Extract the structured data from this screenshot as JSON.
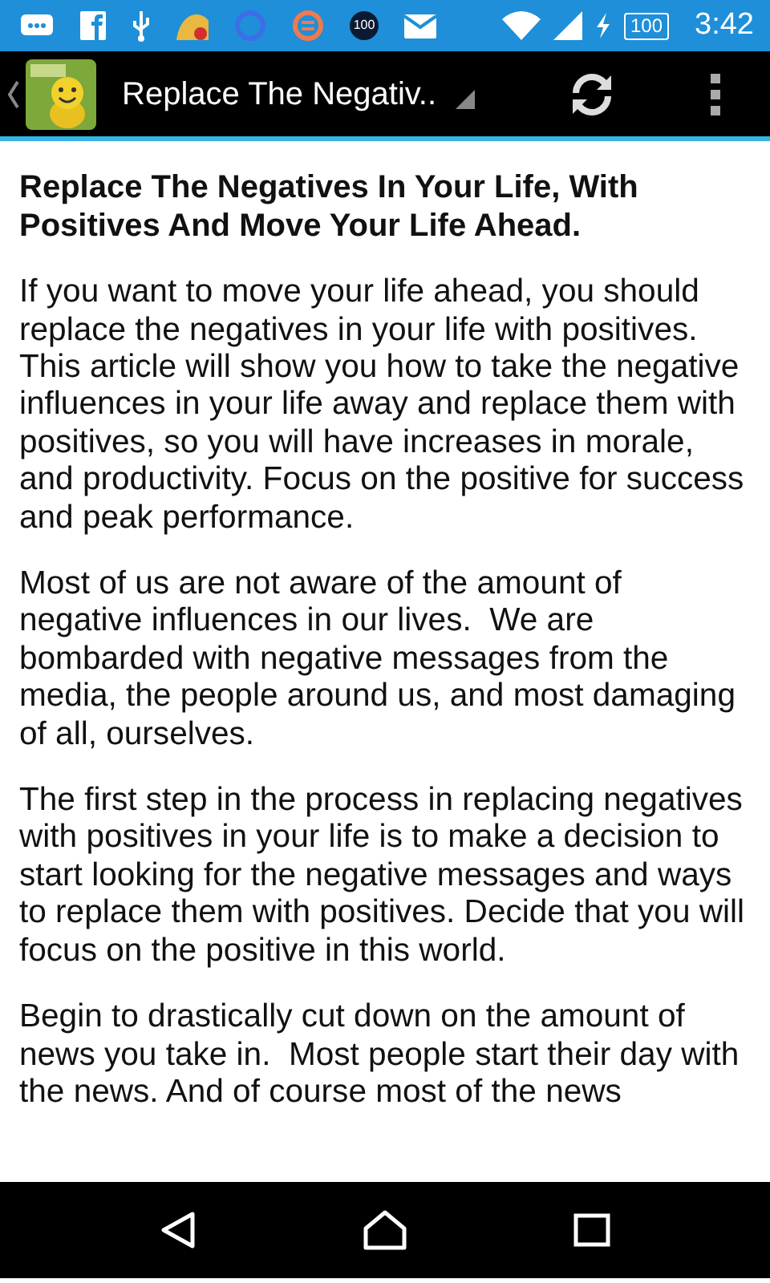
{
  "status_bar": {
    "notification_badge": "100",
    "battery": "100",
    "time": "3:42"
  },
  "app_bar": {
    "title": "Replace The Negativ.."
  },
  "article": {
    "heading": "Replace The Negatives In Your Life, With Positives And Move Your Life Ahead.",
    "paragraphs": [
      "If you want to move your life ahead, you should replace the negatives in your life with positives.  This article will show you how to take the negative influences in your life away and replace them with positives, so you will have increases in morale, and productivity. Focus on the positive for success and peak performance.",
      "Most of us are not aware of the amount of negative influences in our lives.  We are bombarded with negative messages from the media, the people around us, and most damaging of all, ourselves.",
      "The first step in the process in replacing negatives with positives in your life is to make a decision to start looking for the negative messages and ways to replace them with positives. Decide that you will focus on the positive in this world.",
      "Begin to drastically cut down on the amount of news you take in.  Most people start their day with the news. And of course most of the news"
    ]
  }
}
